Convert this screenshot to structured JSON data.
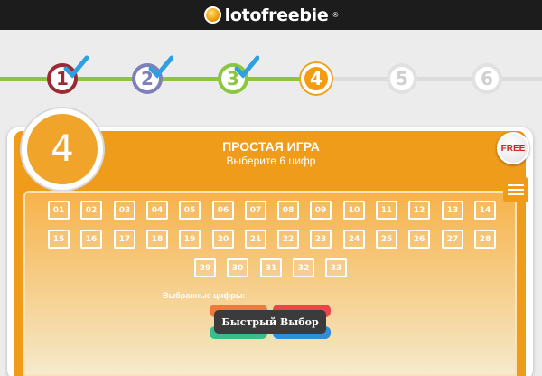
{
  "header": {
    "logo_text": "lotofreebie",
    "logo_reg": "®"
  },
  "steps": {
    "items": [
      {
        "label": "1",
        "state": "done"
      },
      {
        "label": "2",
        "state": "done"
      },
      {
        "label": "3",
        "state": "done"
      },
      {
        "label": "4",
        "state": "current"
      },
      {
        "label": "5",
        "state": "pending"
      },
      {
        "label": "6",
        "state": "pending"
      }
    ],
    "check_icon": "check-icon"
  },
  "game": {
    "step_number": "4",
    "title": "ПРОСТАЯ ИГРА",
    "subtitle": "Выберите 6 цифр",
    "badge": "FREE",
    "numbers": [
      "01",
      "02",
      "03",
      "04",
      "05",
      "06",
      "07",
      "08",
      "09",
      "10",
      "11",
      "12",
      "13",
      "14",
      "15",
      "16",
      "17",
      "18",
      "19",
      "20",
      "21",
      "22",
      "23",
      "24",
      "25",
      "26",
      "27",
      "28",
      "29",
      "30",
      "31",
      "32",
      "33"
    ],
    "selected_label": "Выбранные цифры:",
    "quick_pick_label": "Быстрый Выбор"
  },
  "colors": {
    "accent_orange": "#ef9c1b",
    "done_green": "#8cc63f",
    "step1": "#9b2a34",
    "step2": "#7f80b8",
    "check_blue": "#2e9fe0"
  }
}
